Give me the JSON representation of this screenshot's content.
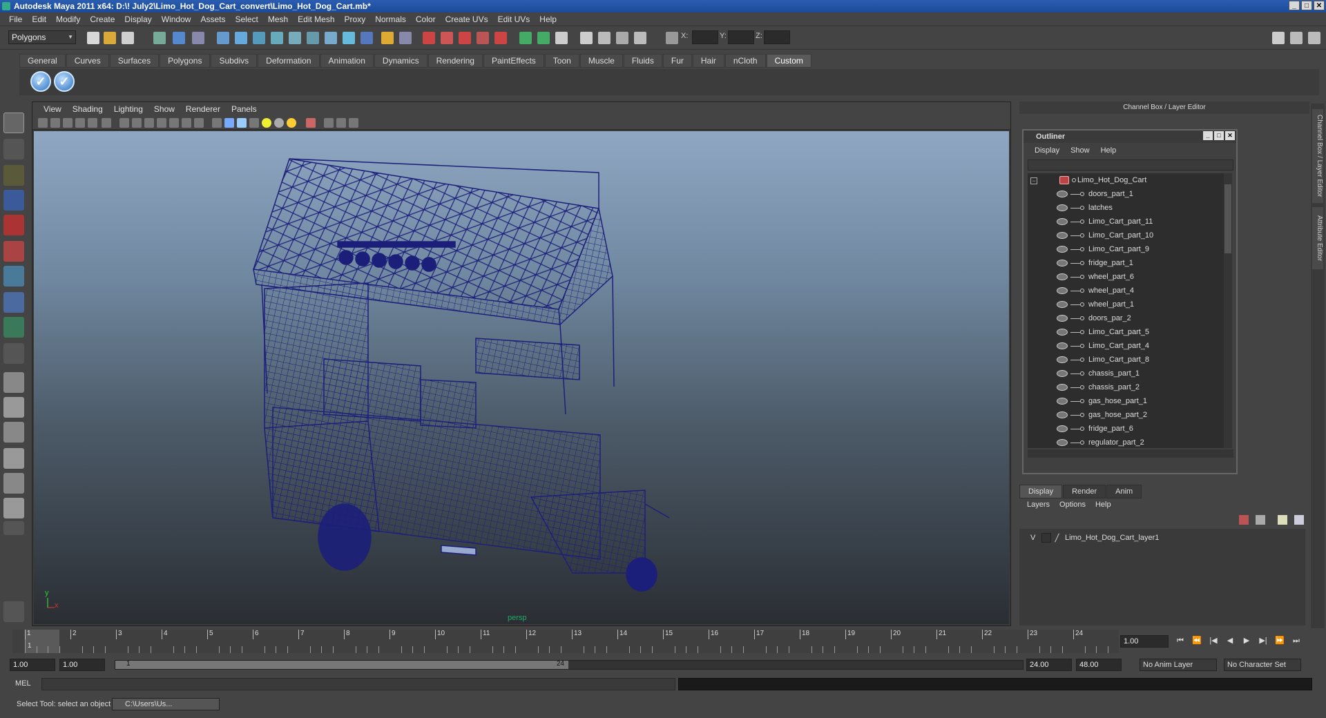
{
  "window": {
    "title": "Autodesk Maya 2011 x64: D:\\! July2\\Limo_Hot_Dog_Cart_convert\\Limo_Hot_Dog_Cart.mb*",
    "minimize": "_",
    "maximize": "□",
    "close": "✕"
  },
  "menubar": [
    "File",
    "Edit",
    "Modify",
    "Create",
    "Display",
    "Window",
    "Assets",
    "Select",
    "Mesh",
    "Edit Mesh",
    "Proxy",
    "Normals",
    "Color",
    "Create UVs",
    "Edit UVs",
    "Help"
  ],
  "statusline": {
    "mode": "Polygons",
    "x_label": "X:",
    "y_label": "Y:",
    "z_label": "Z:"
  },
  "shelf": {
    "tabs": [
      "General",
      "Curves",
      "Surfaces",
      "Polygons",
      "Subdivs",
      "Deformation",
      "Animation",
      "Dynamics",
      "Rendering",
      "PaintEffects",
      "Toon",
      "Muscle",
      "Fluids",
      "Fur",
      "Hair",
      "nCloth",
      "Custom"
    ],
    "active_tab": "Custom"
  },
  "viewport": {
    "menu": [
      "View",
      "Shading",
      "Lighting",
      "Show",
      "Renderer",
      "Panels"
    ],
    "camera_label": "persp",
    "axis_y": "y",
    "axis_x": "x",
    "wire_color": "#1c1f7a"
  },
  "channel_box": {
    "title": "Channel Box / Layer Editor"
  },
  "outliner": {
    "title": "Outliner",
    "menu": [
      "Display",
      "Show",
      "Help"
    ],
    "collapse_symbol": "−",
    "root": "Limo_Hot_Dog_Cart",
    "items": [
      "doors_part_1",
      "latches",
      "Limo_Cart_part_11",
      "Limo_Cart_part_10",
      "Limo_Cart_part_9",
      "fridge_part_1",
      "wheel_part_6",
      "wheel_part_4",
      "wheel_part_1",
      "doors_par_2",
      "Limo_Cart_part_5",
      "Limo_Cart_part_4",
      "Limo_Cart_part_8",
      "chassis_part_1",
      "chassis_part_2",
      "gas_hose_part_1",
      "gas_hose_part_2",
      "fridge_part_6",
      "regulator_part_2"
    ]
  },
  "layer_editor": {
    "tabs": [
      "Display",
      "Render",
      "Anim"
    ],
    "active_tab": "Display",
    "menu": [
      "Layers",
      "Options",
      "Help"
    ],
    "layer": {
      "visible": "V",
      "name": "Limo_Hot_Dog_Cart_layer1"
    }
  },
  "side_tabs": [
    "Channel Box / Layer Editor",
    "Attribute Editor"
  ],
  "timeline": {
    "start_tick": "1",
    "frames": [
      "1",
      "2",
      "3",
      "4",
      "5",
      "6",
      "7",
      "8",
      "9",
      "10",
      "11",
      "12",
      "13",
      "14",
      "15",
      "16",
      "17",
      "18",
      "19",
      "20",
      "21",
      "22",
      "23",
      "24"
    ],
    "current_frame": "1.00",
    "playback_controls": [
      "⏮",
      "⏪",
      "|◀",
      "◀",
      "▶",
      "▶|",
      "⏩",
      "⏭"
    ]
  },
  "range": {
    "start": "1.00",
    "playback_start": "1.00",
    "range_start": "1",
    "range_end": "24",
    "playback_end": "24.00",
    "end": "48.00",
    "anim_layer": "No Anim Layer",
    "character_set": "No Character Set"
  },
  "command_line": {
    "label": "MEL"
  },
  "help_line": {
    "text": "Select Tool: select an object",
    "task": "C:\\Users\\Us..."
  }
}
